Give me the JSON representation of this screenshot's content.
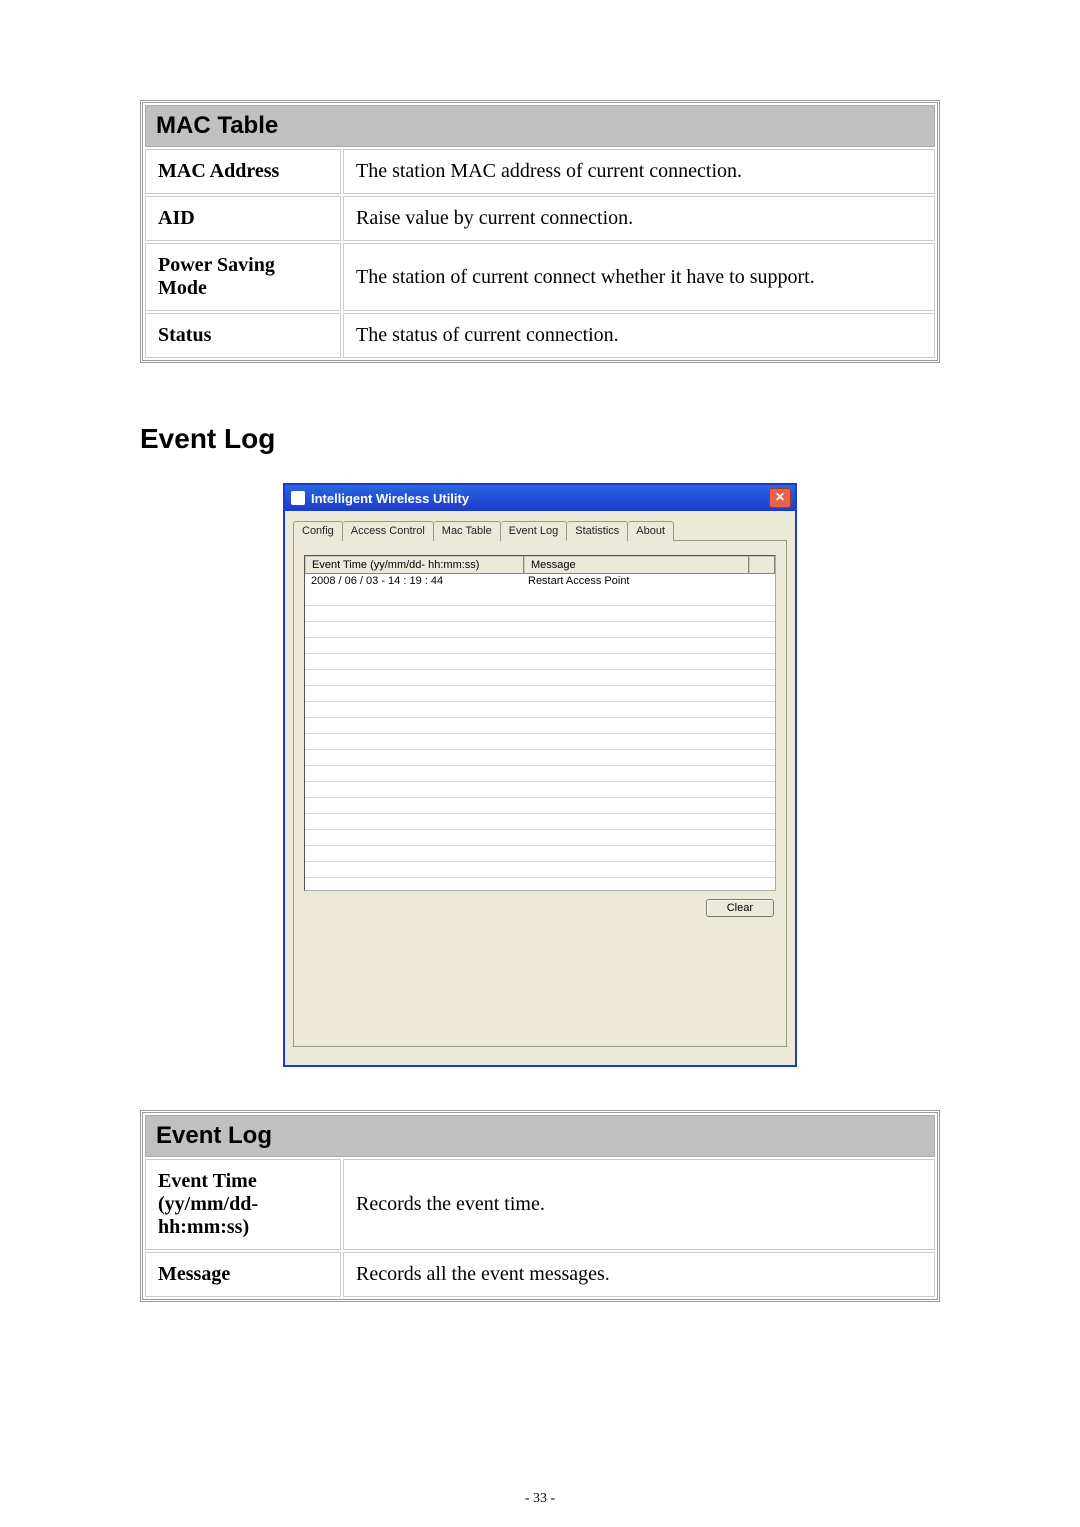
{
  "mac_table": {
    "title": "MAC Table",
    "rows": [
      {
        "label": "MAC Address",
        "desc": "The station MAC address of current connection."
      },
      {
        "label": "AID",
        "desc": "Raise value by current connection."
      },
      {
        "label": "Power Saving Mode",
        "desc": "The station of current connect whether it have to support."
      },
      {
        "label": "Status",
        "desc": "The status of current connection."
      }
    ]
  },
  "heading": "Event Log",
  "utility": {
    "title": "Intelligent Wireless Utility",
    "tabs": [
      "Config",
      "Access Control",
      "Mac Table",
      "Event Log",
      "Statistics",
      "About"
    ],
    "active_tab": "Event Log",
    "columns": {
      "time": "Event Time (yy/mm/dd- hh:mm:ss)",
      "msg": "Message"
    },
    "entries": [
      {
        "time": "2008 / 06 / 03 - 14 : 19 : 44",
        "msg": "Restart Access Point"
      }
    ],
    "clear_label": "Clear"
  },
  "event_log_table": {
    "title": "Event Log",
    "rows": [
      {
        "label_line1": "Event Time",
        "label_line2": "(yy/mm/dd-hh:mm:ss)",
        "desc": "Records the event time."
      },
      {
        "label_line1": "Message",
        "label_line2": "",
        "desc": "Records all the event messages."
      }
    ]
  },
  "page_number": "- 33 -"
}
